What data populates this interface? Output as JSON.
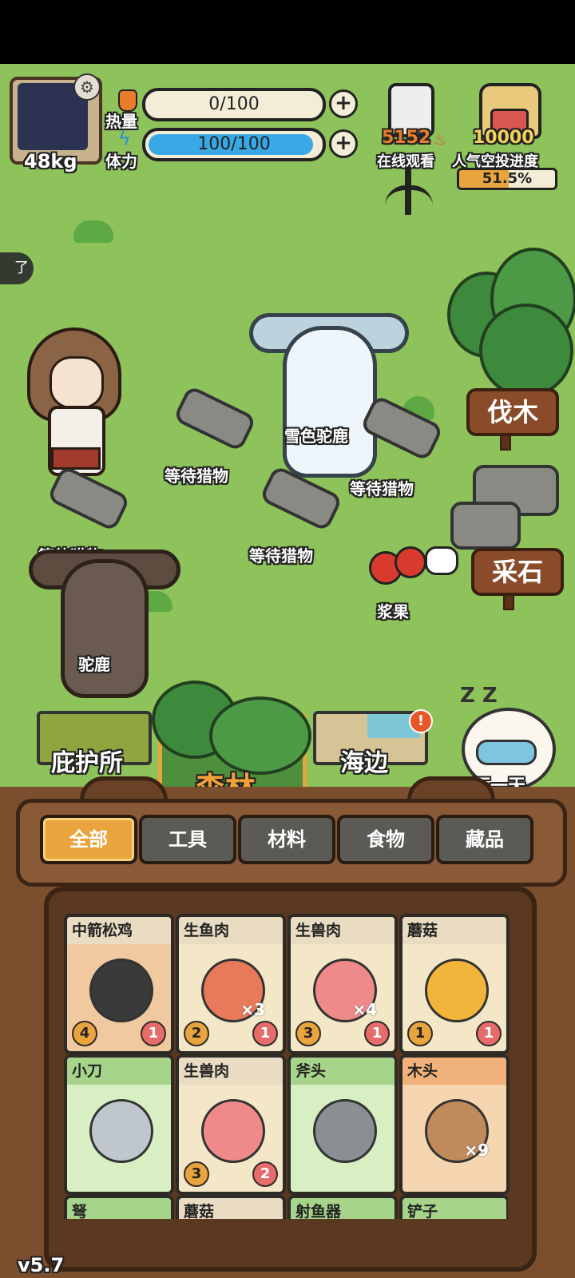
{
  "header": {
    "weight": "48kg",
    "heat_label": "热量",
    "heat_value": "0/100",
    "heat_ratio": 0,
    "stamina_label": "体力",
    "stamina_value": "100/100",
    "stamina_ratio": 1.0,
    "viewers_count": "5152",
    "viewers_label": "在线观看",
    "airdrop_count": "10000",
    "airdrop_label": "人气空投进度",
    "airdrop_progress": "51.5%",
    "airdrop_ratio": 0.515
  },
  "side_hint": "了",
  "field": {
    "animals": [
      {
        "name": "雪色驼鹿"
      },
      {
        "name": "驼鹿"
      }
    ],
    "traps": [
      "等待猎物",
      "等待猎物",
      "等待猎物",
      "等待猎物"
    ],
    "berries_label": "浆果",
    "actions": {
      "chop": "伐木",
      "mine": "采石"
    }
  },
  "map_tabs": [
    {
      "label": "庇护所",
      "selected": false
    },
    {
      "label": "森林",
      "selected": true
    },
    {
      "label": "海边",
      "selected": false,
      "alert": "!"
    }
  ],
  "next_day": {
    "label": "下一天",
    "sleep_mark": "Z Z"
  },
  "categories": [
    {
      "label": "全部",
      "active": true
    },
    {
      "label": "工具",
      "active": false
    },
    {
      "label": "材料",
      "active": false
    },
    {
      "label": "食物",
      "active": false
    },
    {
      "label": "藏品",
      "active": false
    }
  ],
  "items": [
    {
      "name": "中箭松鸡",
      "left_count": "4",
      "right_count": "1",
      "stack": "",
      "icon": "grouse-icon",
      "head_color": "#e9dcc3",
      "body_color": "#f0c9a0"
    },
    {
      "name": "生鱼肉",
      "left_count": "2",
      "right_count": "1",
      "stack": "×3",
      "icon": "fish-meat-icon",
      "head_color": "#e9dcc3",
      "body_color": "#f3e7c8"
    },
    {
      "name": "生兽肉",
      "left_count": "3",
      "right_count": "1",
      "stack": "×4",
      "icon": "raw-meat-icon",
      "head_color": "#e9dcc3",
      "body_color": "#f3e7c8"
    },
    {
      "name": "蘑菇",
      "left_count": "1",
      "right_count": "1",
      "stack": "",
      "icon": "mushroom-icon",
      "head_color": "#e9dcc3",
      "body_color": "#f3e7c8"
    },
    {
      "name": "小刀",
      "left_count": "",
      "right_count": "",
      "stack": "",
      "icon": "knife-icon",
      "head_color": "#a6d48a",
      "body_color": "#d8efc4"
    },
    {
      "name": "生兽肉",
      "left_count": "3",
      "right_count": "2",
      "stack": "",
      "icon": "raw-meat-icon",
      "head_color": "#e9dcc3",
      "body_color": "#f3e7c8"
    },
    {
      "name": "斧头",
      "left_count": "",
      "right_count": "",
      "stack": "",
      "icon": "axe-icon",
      "head_color": "#a6d48a",
      "body_color": "#d8efc4"
    },
    {
      "name": "木头",
      "left_count": "",
      "right_count": "",
      "stack": "×9",
      "icon": "wood-icon",
      "head_color": "#f0b27a",
      "body_color": "#f6d6b0"
    }
  ],
  "items_partial": [
    "弩",
    "蘑菇",
    "射鱼器",
    "铲子"
  ],
  "version": "v5.7",
  "colors": {
    "accent": "#e9a43e",
    "grass": "#8ec25a",
    "stamina_bar": "#38a8e6"
  }
}
